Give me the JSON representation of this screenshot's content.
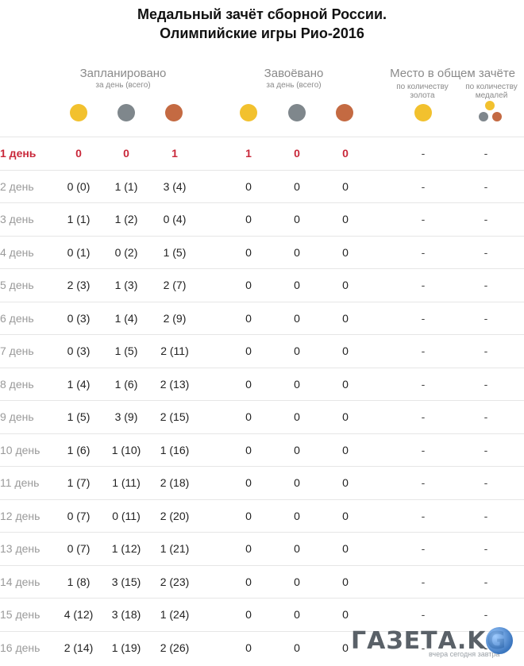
{
  "title": {
    "line1": "Медальный зачёт сборной России.",
    "line2": "Олимпийские игры Рио-2016"
  },
  "headers": {
    "planned": {
      "label": "Запланировано",
      "sub": "за день (всего)"
    },
    "won": {
      "label": "Завоёвано",
      "sub": "за день (всего)"
    },
    "place": {
      "label": "Место в общем зачёте",
      "by_gold": "по количеству золота",
      "by_gold_l1": "по количеству",
      "by_gold_l2": "золота",
      "by_medals_l1": "по количеству",
      "by_medals_l2": "медалей"
    }
  },
  "colors": {
    "gold": "#f2c12e",
    "silver": "#7f878c",
    "bronze": "#c46a42",
    "highlight": "#c9283a"
  },
  "rows": [
    {
      "day": "1 день",
      "pg": "0",
      "ps": "0",
      "pb": "1",
      "wg": "1",
      "ws": "0",
      "wb": "0",
      "rank_gold": "-",
      "rank_total": "-"
    },
    {
      "day": "2 день",
      "pg": "0 (0)",
      "ps": "1 (1)",
      "pb": "3 (4)",
      "wg": "0",
      "ws": "0",
      "wb": "0",
      "rank_gold": "-",
      "rank_total": "-"
    },
    {
      "day": "3 день",
      "pg": "1 (1)",
      "ps": "1 (2)",
      "pb": "0 (4)",
      "wg": "0",
      "ws": "0",
      "wb": "0",
      "rank_gold": "-",
      "rank_total": "-"
    },
    {
      "day": "4 день",
      "pg": "0 (1)",
      "ps": "0 (2)",
      "pb": "1 (5)",
      "wg": "0",
      "ws": "0",
      "wb": "0",
      "rank_gold": "-",
      "rank_total": "-"
    },
    {
      "day": "5 день",
      "pg": "2 (3)",
      "ps": "1 (3)",
      "pb": "2 (7)",
      "wg": "0",
      "ws": "0",
      "wb": "0",
      "rank_gold": "-",
      "rank_total": "-"
    },
    {
      "day": "6 день",
      "pg": "0 (3)",
      "ps": "1 (4)",
      "pb": "2 (9)",
      "wg": "0",
      "ws": "0",
      "wb": "0",
      "rank_gold": "-",
      "rank_total": "-"
    },
    {
      "day": "7 день",
      "pg": "0 (3)",
      "ps": "1 (5)",
      "pb": "2 (11)",
      "wg": "0",
      "ws": "0",
      "wb": "0",
      "rank_gold": "-",
      "rank_total": "-"
    },
    {
      "day": "8 день",
      "pg": "1 (4)",
      "ps": "1 (6)",
      "pb": "2 (13)",
      "wg": "0",
      "ws": "0",
      "wb": "0",
      "rank_gold": "-",
      "rank_total": "-"
    },
    {
      "day": "9 день",
      "pg": "1 (5)",
      "ps": "3 (9)",
      "pb": "2 (15)",
      "wg": "0",
      "ws": "0",
      "wb": "0",
      "rank_gold": "-",
      "rank_total": "-"
    },
    {
      "day": "10 день",
      "pg": "1 (6)",
      "ps": "1 (10)",
      "pb": "1 (16)",
      "wg": "0",
      "ws": "0",
      "wb": "0",
      "rank_gold": "-",
      "rank_total": "-"
    },
    {
      "day": "11 день",
      "pg": "1 (7)",
      "ps": "1 (11)",
      "pb": "2 (18)",
      "wg": "0",
      "ws": "0",
      "wb": "0",
      "rank_gold": "-",
      "rank_total": "-"
    },
    {
      "day": "12 день",
      "pg": "0 (7)",
      "ps": "0 (11)",
      "pb": "2 (20)",
      "wg": "0",
      "ws": "0",
      "wb": "0",
      "rank_gold": "-",
      "rank_total": "-"
    },
    {
      "day": "13 день",
      "pg": "0 (7)",
      "ps": "1 (12)",
      "pb": "1 (21)",
      "wg": "0",
      "ws": "0",
      "wb": "0",
      "rank_gold": "-",
      "rank_total": "-"
    },
    {
      "day": "14 день",
      "pg": "1 (8)",
      "ps": "3 (15)",
      "pb": "2 (23)",
      "wg": "0",
      "ws": "0",
      "wb": "0",
      "rank_gold": "-",
      "rank_total": "-"
    },
    {
      "day": "15 день",
      "pg": "4 (12)",
      "ps": "3 (18)",
      "pb": "1 (24)",
      "wg": "0",
      "ws": "0",
      "wb": "0",
      "rank_gold": "-",
      "rank_total": "-"
    },
    {
      "day": "16 день",
      "pg": "2 (14)",
      "ps": "1 (19)",
      "pb": "2 (26)",
      "wg": "0",
      "ws": "0",
      "wb": "0",
      "rank_gold": "-",
      "rank_total": "-"
    }
  ],
  "watermark": {
    "brand": "ГАЗЕТА.KG",
    "tagline": "вчера сегодня завтра"
  }
}
